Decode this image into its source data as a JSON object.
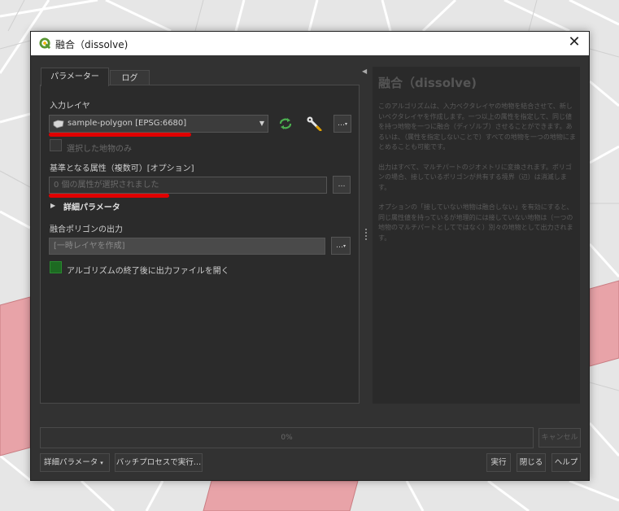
{
  "dialog": {
    "title": "融合（dissolve)",
    "close_glyph": "✕"
  },
  "tabs": [
    {
      "label": "パラメーター",
      "active": true
    },
    {
      "label": "ログ",
      "active": false
    }
  ],
  "params": {
    "input_layer_label": "入力レイヤ",
    "input_layer_value": "sample-polygon [EPSG:6680]",
    "selected_only_label": "選択した地物のみ",
    "selected_only_checked": false,
    "dissolve_field_label": "基準となる属性（複数可）[オプション]",
    "dissolve_field_value": "0 個の属性が選択されました",
    "advanced_label": "詳細パラメータ",
    "output_label": "融合ポリゴンの出力",
    "output_value": "[一時レイヤを作成]",
    "open_output_label": "アルゴリズムの終了後に出力ファイルを開く",
    "open_output_checked": true,
    "more_button": "…",
    "combo_arrow": "▼"
  },
  "help": {
    "title": "融合（dissolve)",
    "paragraphs": [
      "このアルゴリズムは、入力ベクタレイヤの地物を結合させて、新しいベクタレイヤを作成します。一つ以上の属性を指定して、同じ値を持つ地物を一つに融合（ディゾルブ）させることができます。あるいは、（属性を指定しないことで）すべての地物を一つの地物にまとめることも可能です。",
      "出力はすべて、マルチパートのジオメトリに変換されます。ポリゴンの場合、接しているポリゴンが共有する境界（辺）は消滅します。",
      "オプションの「接していない地物は融合しない」を有効にすると、同じ属性値を持っているが地理的には接していない地物は（一つの地物のマルチパートとしてではなく）別々の地物として出力されます。"
    ]
  },
  "footer": {
    "progress_text": "0%",
    "progress": 0,
    "cancel": "キャンセル",
    "advanced": "詳細パラメータ",
    "batch": "バッチプロセスで実行…",
    "run": "実行",
    "close": "閉じる",
    "help": "ヘルプ"
  },
  "colors": {
    "qgis_green": "#589632",
    "annotation_red": "#e00000",
    "polygon_fill": "#e8a3a8",
    "checkbox_on": "#1d6a22"
  },
  "icons": [
    "qgis-logo-icon",
    "layer-iterate-icon",
    "wrench-icon",
    "triangle-right-icon",
    "close-icon"
  ]
}
